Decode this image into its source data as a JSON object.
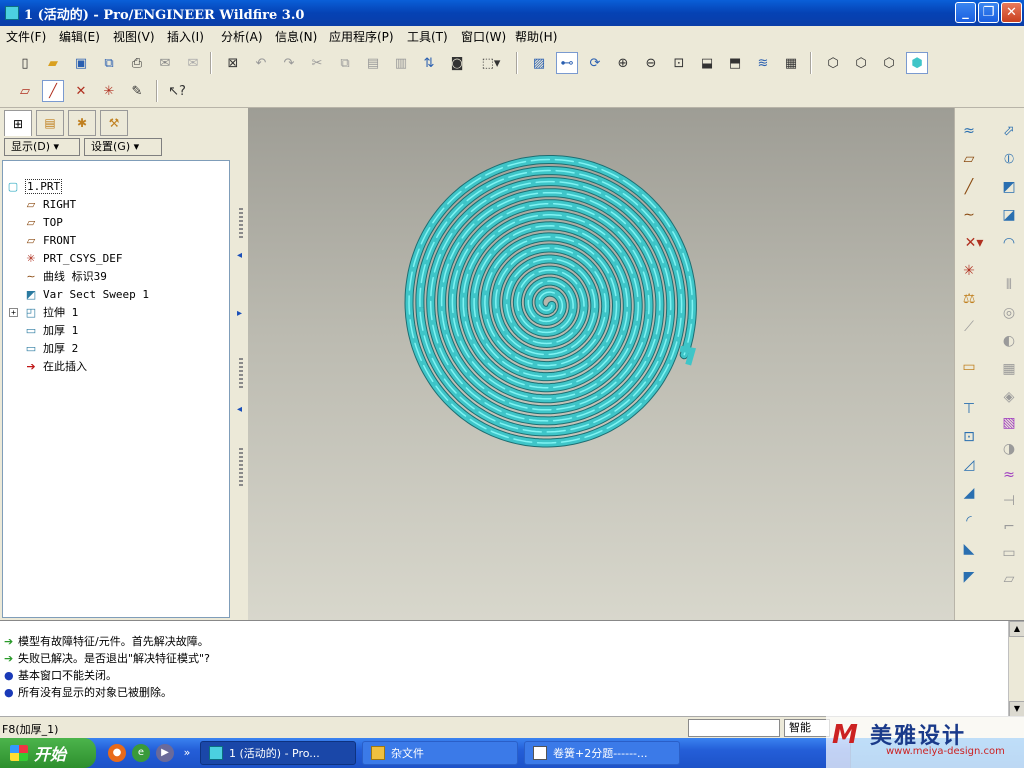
{
  "window": {
    "title": "1 (活动的) - Pro/ENGINEER Wildfire 3.0",
    "minimize": "_",
    "maximize": "❐",
    "close": "✕"
  },
  "menu": [
    "文件(F)",
    "编辑(E)",
    "视图(V)",
    "插入(I)",
    "分析(A)",
    "信息(N)",
    "应用程序(P)",
    "工具(T)",
    "窗口(W)",
    "帮助(H)"
  ],
  "toolbar": {
    "icons_row1": [
      "new-icon",
      "open-icon",
      "save-icon",
      "save-copy-icon",
      "print-icon",
      "send-mail-icon",
      "send-mail2-icon",
      "close-window-icon",
      "undo-icon",
      "redo-icon",
      "cut-icon",
      "copy-icon",
      "paste-icon",
      "paste-special-icon",
      "regenerate-icon",
      "find-icon",
      "select-box-icon",
      "repaint-icon",
      "spin-center-icon",
      "orient-icon",
      "zoom-in-icon",
      "zoom-out-icon",
      "refit-icon",
      "reorient-icon",
      "saved-views-icon",
      "layers-icon",
      "view-manager-icon",
      "wireframe-icon",
      "hidden-line-icon",
      "no-hidden-icon",
      "shading-icon"
    ],
    "icons_row2": [
      "datum-plane-display-icon",
      "datum-axis-display-icon",
      "datum-point-display-icon",
      "csys-display-icon",
      "annotation-display-icon",
      "context-help-icon"
    ]
  },
  "left_panel": {
    "tabs": [
      "model-tree-tab",
      "folder-browser-tab",
      "favorites-tab",
      "connections-tab"
    ],
    "show_button": "显示(D) ▾",
    "settings_button": "设置(G) ▾",
    "tree": [
      {
        "label": "1.PRT",
        "icon": "part-icon"
      },
      {
        "label": "RIGHT",
        "icon": "datum-plane-icon"
      },
      {
        "label": "TOP",
        "icon": "datum-plane-icon"
      },
      {
        "label": "FRONT",
        "icon": "datum-plane-icon"
      },
      {
        "label": "PRT_CSYS_DEF",
        "icon": "csys-icon"
      },
      {
        "label": "曲线 标识39",
        "icon": "curve-icon"
      },
      {
        "label": "Var Sect Sweep 1",
        "icon": "sweep-icon"
      },
      {
        "label": "拉伸 1",
        "icon": "extrude-icon"
      },
      {
        "label": "加厚 1",
        "icon": "thicken-icon"
      },
      {
        "label": "加厚 2",
        "icon": "thicken-icon"
      },
      {
        "label": "在此插入",
        "icon": "insert-here-icon"
      }
    ]
  },
  "model": {
    "color": "#3fc5c8",
    "edge_color": "#1d6e72",
    "highlight": "#7ff3f3"
  },
  "messages": [
    {
      "type": "arrow",
      "text": "模型有故障特征/元件。首先解决故障。"
    },
    {
      "type": "arrow",
      "text": "失败已解决。是否退出\"解决特征模式\"?"
    },
    {
      "type": "bullet",
      "text": "基本窗口不能关闭。"
    },
    {
      "type": "bullet",
      "text": "所有没有显示的对象已被删除。"
    }
  ],
  "status": {
    "left": "F8(加厚_1)",
    "filter": "智能"
  },
  "taskbar": {
    "start": "开始",
    "tasks": [
      "1 (活动的) - Pro...",
      "杂文件",
      "卷簧+2分题------..."
    ]
  },
  "watermark": {
    "brand": "美雅设计",
    "url": "www.meiya-design.com"
  }
}
